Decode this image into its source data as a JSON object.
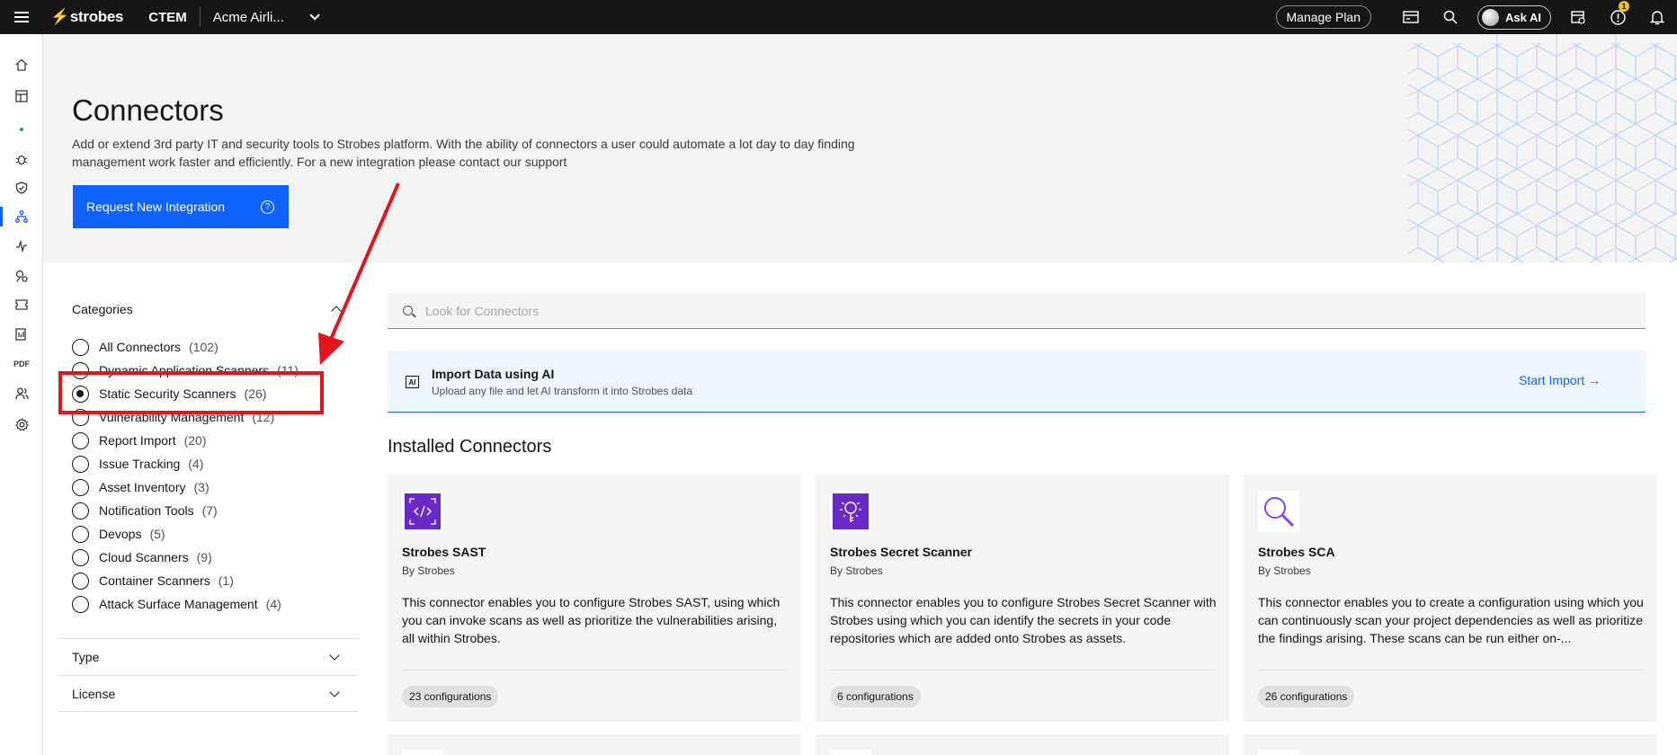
{
  "topbar": {
    "brand": "strobes",
    "product": "CTEM",
    "org": "Acme Airli...",
    "manage_plan": "Manage Plan",
    "ask_ai": "Ask AI",
    "notif_badge": "1",
    "icons": [
      "menu-icon",
      "billing-icon",
      "search-icon",
      "calendar-icon",
      "info-icon",
      "bell-icon"
    ]
  },
  "rail": {
    "items": [
      "home-icon",
      "dashboard-icon",
      "dot-icon",
      "bug-icon",
      "shield-check-icon",
      "connectors-icon",
      "activity-icon",
      "insights-icon",
      "ticket-icon",
      "report-icon",
      "PDF",
      "users-icon",
      "settings-icon"
    ],
    "active_index": 5,
    "pdf_label": "PDF"
  },
  "hero": {
    "title": "Connectors",
    "description": "Add or extend 3rd party IT and security tools to Strobes platform. With the ability of connectors a user could automate a lot day to day finding management work faster and efficiently. For a new integration please contact our support",
    "request_button": "Request New Integration",
    "help_glyph": "?"
  },
  "filters": {
    "categories_label": "Categories",
    "categories": [
      {
        "label": "All Connectors",
        "count": "(102)",
        "checked": false
      },
      {
        "label": "Dynamic Application Scanners",
        "count": "(11)",
        "checked": false
      },
      {
        "label": "Static Security Scanners",
        "count": "(26)",
        "checked": true
      },
      {
        "label": "Vulnerability Management",
        "count": "(12)",
        "checked": false
      },
      {
        "label": "Report Import",
        "count": "(20)",
        "checked": false
      },
      {
        "label": "Issue Tracking",
        "count": "(4)",
        "checked": false
      },
      {
        "label": "Asset Inventory",
        "count": "(3)",
        "checked": false
      },
      {
        "label": "Notification Tools",
        "count": "(7)",
        "checked": false
      },
      {
        "label": "Devops",
        "count": "(5)",
        "checked": false
      },
      {
        "label": "Cloud Scanners",
        "count": "(9)",
        "checked": false
      },
      {
        "label": "Container Scanners",
        "count": "(1)",
        "checked": false
      },
      {
        "label": "Attack Surface Management",
        "count": "(4)",
        "checked": false
      }
    ],
    "type_label": "Type",
    "license_label": "License"
  },
  "search": {
    "placeholder": "Look for Connectors"
  },
  "import_banner": {
    "icon_text": "AI",
    "title": "Import Data using AI",
    "subtitle": "Upload any file and let AI transform it into Strobes data",
    "action": "Start Import →"
  },
  "installed": {
    "heading": "Installed Connectors",
    "cards": [
      {
        "name": "Strobes SAST",
        "by": "By Strobes",
        "description": "This connector enables you to configure Strobes SAST, using which you can invoke scans as well as prioritize the vulnerabilities arising, all within Strobes.",
        "configurations": "23 configurations",
        "icon": "code-icon",
        "logo_color": "#6929c4"
      },
      {
        "name": "Strobes Secret Scanner",
        "by": "By Strobes",
        "description": "This connector enables you to configure Strobes Secret Scanner with Strobes using which you can identify the secrets in your code repositories which are added onto Strobes as assets.",
        "configurations": "6 configurations",
        "icon": "key-scan-icon",
        "logo_color": "#6929c4"
      },
      {
        "name": "Strobes SCA",
        "by": "By Strobes",
        "description": "This connector enables you to create a configuration using which you can continuously scan your project dependencies as well as prioritize the findings arising. These scans can be run either on-...",
        "configurations": "26 configurations",
        "icon": "magnifier-icon",
        "logo_color": "#8a3ffc"
      }
    ]
  },
  "colors": {
    "accent": "#0f62fe",
    "topbar": "#161616",
    "annotation": "#e3141b"
  }
}
